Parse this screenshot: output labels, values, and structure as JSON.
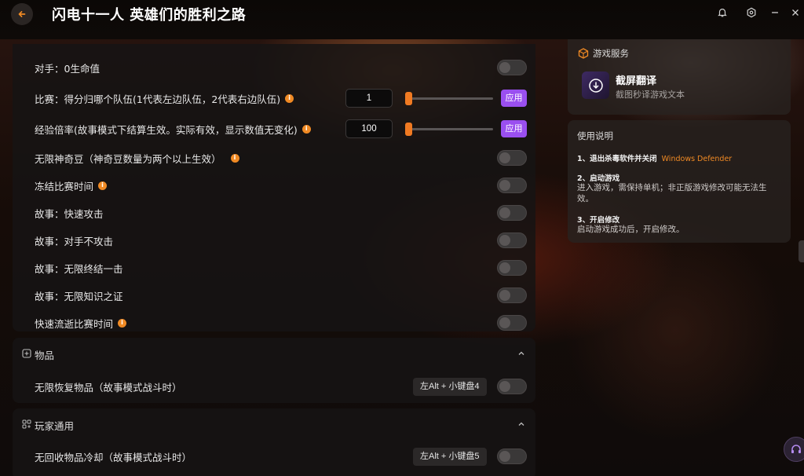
{
  "window": {
    "title": "闪电十一人 英雄们的胜利之路"
  },
  "main_options": [
    {
      "label": "对手：0生命值",
      "info": false,
      "control": "toggle",
      "enabled": false
    },
    {
      "label": "比赛：得分归哪个队伍(1代表左边队伍，2代表右边队伍)",
      "info": true,
      "control": "number",
      "value": "1",
      "apply": "应用",
      "slider_fraction": 0
    },
    {
      "label": "经验倍率(故事模式下结算生效。实际有效，显示数值无变化)",
      "info": true,
      "control": "number",
      "value": "100",
      "apply": "应用",
      "slider_fraction": 0
    },
    {
      "label": "无限神奇豆（神奇豆数量为两个以上生效）",
      "info": true,
      "control": "toggle",
      "enabled": false
    },
    {
      "label": "冻结比赛时间",
      "info": true,
      "control": "toggle",
      "enabled": false
    },
    {
      "label": "故事：快速攻击",
      "info": false,
      "control": "toggle",
      "enabled": false
    },
    {
      "label": "故事：对手不攻击",
      "info": false,
      "control": "toggle",
      "enabled": false
    },
    {
      "label": "故事：无限终结一击",
      "info": false,
      "control": "toggle",
      "enabled": false
    },
    {
      "label": "故事：无限知识之证",
      "info": false,
      "control": "toggle",
      "enabled": false
    },
    {
      "label": "快速流逝比赛时间",
      "info": true,
      "control": "toggle",
      "enabled": false
    }
  ],
  "sections": [
    {
      "title": "物品",
      "icon": "plus-square-icon",
      "items": [
        {
          "label": "无限恢复物品（故事模式战斗时）",
          "hotkey": "左Alt + 小键盘4",
          "enabled": false
        }
      ]
    },
    {
      "title": "玩家通用",
      "icon": "grid-icon",
      "items": [
        {
          "label": "无回收物品冷却（故事模式战斗时）",
          "hotkey": "左Alt + 小键盘5",
          "enabled": false
        }
      ]
    }
  ],
  "game_service": {
    "title": "游戏服务",
    "tool_name": "截屏翻译",
    "tool_desc": "截图秒译游戏文本"
  },
  "usage": {
    "title": "使用说明",
    "steps": [
      {
        "title": "1、退出杀毒软件并关闭",
        "link": "Windows Defender",
        "body": ""
      },
      {
        "title": "2、启动游戏",
        "link": "",
        "body": "进入游戏，需保持单机；非正版游戏修改可能无法生效。"
      },
      {
        "title": "3、开启修改",
        "link": "",
        "body": "启动游戏成功后，开启修改。"
      }
    ]
  },
  "colors": {
    "accent_orange": "#f08a24",
    "apply_purple": "#9a4ff0"
  }
}
